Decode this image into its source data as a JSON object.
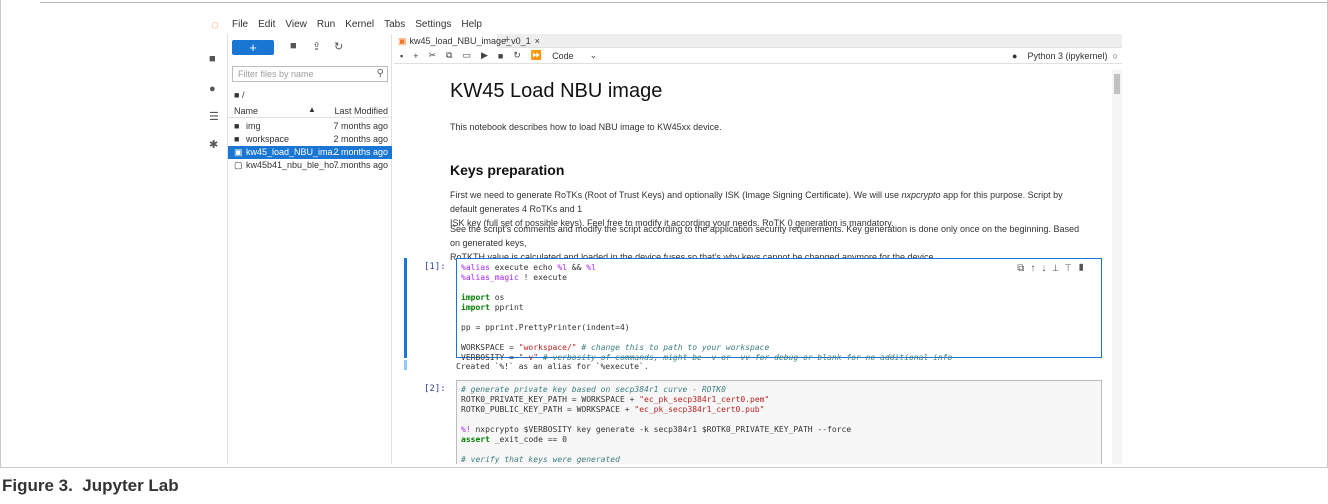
{
  "menubar": {
    "items": [
      "File",
      "Edit",
      "View",
      "Run",
      "Kernel",
      "Tabs",
      "Settings",
      "Help"
    ]
  },
  "sidebar": {
    "new_label": "+",
    "filter_placeholder": "Filter files by name",
    "breadcrumb": "/",
    "columns": {
      "name": "Name",
      "modified": "Last Modified"
    },
    "files": [
      {
        "name": "img",
        "modified": "7 months ago",
        "icon": "folder-icon"
      },
      {
        "name": "workspace",
        "modified": "2 months ago",
        "icon": "folder-icon"
      },
      {
        "name": "kw45_load_NBU_ima...",
        "modified": "2 months ago",
        "icon": "notebook-icon",
        "selected": true
      },
      {
        "name": "kw45b41_nbu_ble_ho...",
        "modified": "7 months ago",
        "icon": "file-icon"
      }
    ]
  },
  "tabs": [
    {
      "label": "kw45_load_NBU_image_v0_1"
    }
  ],
  "toolbar": {
    "cell_type": "Code",
    "kernel": "Python 3 (ipykernel)"
  },
  "notebook": {
    "title": "KW45 Load NBU image",
    "intro": "This notebook describes how to load NBU image to KW45xx device.",
    "section": "Keys preparation",
    "para1_a": "First we need to generate RoTKs (Root of Trust Keys) and optionally ISK (Image Signing Certificate). We will use ",
    "para1_em": "nxpcrypto",
    "para1_b": " app for this purpose. Script by default generates 4 RoTKs and 1",
    "para1_line2": "ISK key (full set of possible keys). Feel free to modify it according your needs. RoTK 0 generation is mandatory.",
    "para2_line1": "See the script's comments and modify the script according to the application security requirements. Key generation is done only once on the beginning. Based on generated keys,",
    "para2_line2": "RoTKTH value is calculated and loaded in the device fuses so that's why keys cannot be changed anymore for the device.",
    "cell1_prompt": "[1]:",
    "cell1_output": "Created `%!` as an alias for `%execute`.",
    "cell2_prompt": "[2]:"
  },
  "colors": {
    "accent": "#1976d2",
    "logo": "#f37726"
  }
}
